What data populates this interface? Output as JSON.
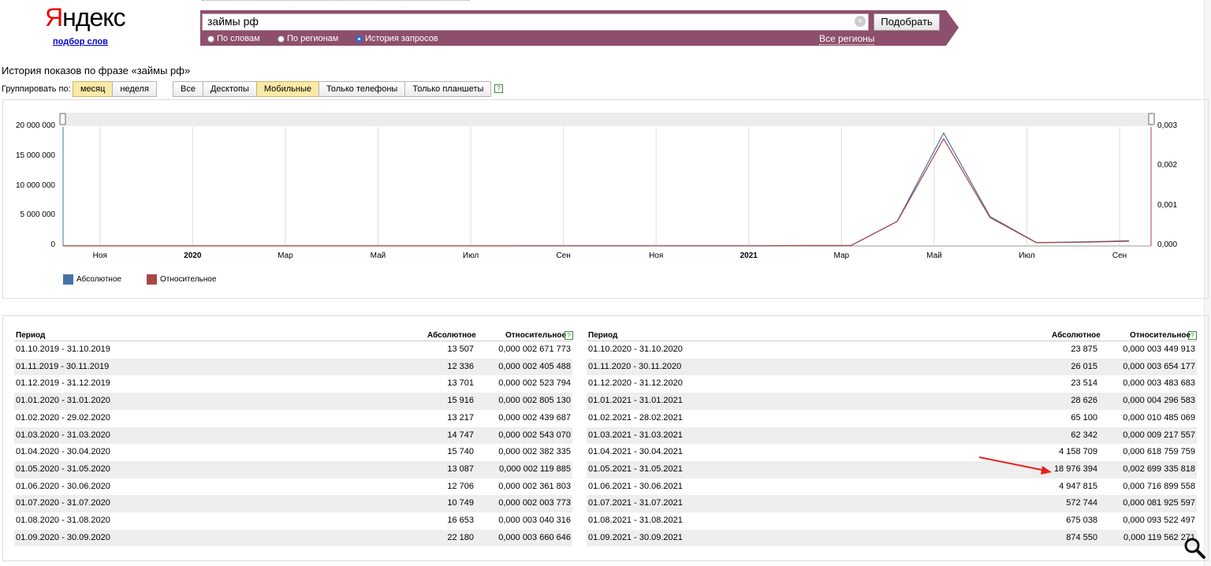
{
  "logo": {
    "first_letter": "Я",
    "rest": "ндекс",
    "sublink": "подбор слов"
  },
  "search": {
    "value": "займы рф",
    "button": "Подобрать",
    "regions": "Все регионы",
    "modes": [
      {
        "label": "По словам",
        "selected": false
      },
      {
        "label": "По регионам",
        "selected": false
      },
      {
        "label": "История запросов",
        "selected": true
      }
    ]
  },
  "history_title": "История показов по фразе «займы рф»",
  "group_label": "Группировать по:",
  "group_buttons": [
    {
      "label": "месяц",
      "active": true
    },
    {
      "label": "неделя",
      "active": false
    }
  ],
  "device_buttons": [
    {
      "label": "Все",
      "active": false
    },
    {
      "label": "Десктопы",
      "active": false
    },
    {
      "label": "Мобильные",
      "active": true
    },
    {
      "label": "Только телефоны",
      "active": false
    },
    {
      "label": "Только планшеты",
      "active": false
    }
  ],
  "help_glyph": "?",
  "chart_data": {
    "type": "line",
    "y_left_ticks": [
      "20 000 000",
      "15 000 000",
      "10 000 000",
      "5 000 000",
      "0"
    ],
    "y_right_ticks": [
      "0,003",
      "0,002",
      "0,001",
      "0,000"
    ],
    "x_ticks": [
      {
        "label": "Ноя",
        "bold": false
      },
      {
        "label": "2020",
        "bold": true
      },
      {
        "label": "Мар",
        "bold": false
      },
      {
        "label": "Май",
        "bold": false
      },
      {
        "label": "Июл",
        "bold": false
      },
      {
        "label": "Сен",
        "bold": false
      },
      {
        "label": "Ноя",
        "bold": false
      },
      {
        "label": "2021",
        "bold": true
      },
      {
        "label": "Мар",
        "bold": false
      },
      {
        "label": "Май",
        "bold": false
      },
      {
        "label": "Июл",
        "bold": false
      },
      {
        "label": "Сен",
        "bold": false
      }
    ],
    "ylim_left": [
      0,
      20000000
    ],
    "ylim_right": [
      0,
      0.003
    ],
    "series": [
      {
        "name": "Абсолютное",
        "color": "#4572a7",
        "values": [
          13507,
          12336,
          13701,
          15916,
          13217,
          14747,
          15740,
          13087,
          12706,
          10749,
          16653,
          22180,
          23875,
          26015,
          23514,
          28626,
          65100,
          62342,
          4158709,
          18976394,
          4947815,
          572744,
          675038,
          874550
        ]
      },
      {
        "name": "Относительное",
        "color": "#aa4643",
        "values": [
          2.671773e-06,
          2.405488e-06,
          2.523794e-06,
          2.80513e-06,
          2.439687e-06,
          2.54307e-06,
          2.382335e-06,
          2.119885e-06,
          2.361803e-06,
          2.003773e-06,
          3.040316e-06,
          3.660646e-06,
          3.449913e-06,
          3.654177e-06,
          3.483683e-06,
          4.296583e-06,
          1.0485069e-05,
          9.217557e-06,
          0.000618759759,
          0.002699335818,
          0.000716899558,
          8.1925597e-05,
          9.3522497e-05,
          0.000119562271
        ]
      }
    ]
  },
  "table": {
    "headers": {
      "period": "Период",
      "absolute": "Абсолютное",
      "relative": "Относительное"
    },
    "left": [
      [
        "01.10.2019 - 31.10.2019",
        "13 507",
        "0,000 002 671 773"
      ],
      [
        "01.11.2019 - 30.11.2019",
        "12 336",
        "0,000 002 405 488"
      ],
      [
        "01.12.2019 - 31.12.2019",
        "13 701",
        "0,000 002 523 794"
      ],
      [
        "01.01.2020 - 31.01.2020",
        "15 916",
        "0,000 002 805 130"
      ],
      [
        "01.02.2020 - 29.02.2020",
        "13 217",
        "0,000 002 439 687"
      ],
      [
        "01.03.2020 - 31.03.2020",
        "14 747",
        "0,000 002 543 070"
      ],
      [
        "01.04.2020 - 30.04.2020",
        "15 740",
        "0,000 002 382 335"
      ],
      [
        "01.05.2020 - 31.05.2020",
        "13 087",
        "0,000 002 119 885"
      ],
      [
        "01.06.2020 - 30.06.2020",
        "12 706",
        "0,000 002 361 803"
      ],
      [
        "01.07.2020 - 31.07.2020",
        "10 749",
        "0,000 002 003 773"
      ],
      [
        "01.08.2020 - 31.08.2020",
        "16 653",
        "0,000 003 040 316"
      ],
      [
        "01.09.2020 - 30.09.2020",
        "22 180",
        "0,000 003 660 646"
      ]
    ],
    "right": [
      [
        "01.10.2020 - 31.10.2020",
        "23 875",
        "0,000 003 449 913"
      ],
      [
        "01.11.2020 - 30.11.2020",
        "26 015",
        "0,000 003 654 177"
      ],
      [
        "01.12.2020 - 31.12.2020",
        "23 514",
        "0,000 003 483 683"
      ],
      [
        "01.01.2021 - 31.01.2021",
        "28 626",
        "0,000 004 296 583"
      ],
      [
        "01.02.2021 - 28.02.2021",
        "65 100",
        "0,000 010 485 069"
      ],
      [
        "01.03.2021 - 31.03.2021",
        "62 342",
        "0,000 009 217 557"
      ],
      [
        "01.04.2021 - 30.04.2021",
        "4 158 709",
        "0,000 618 759 759"
      ],
      [
        "01.05.2021 - 31.05.2021",
        "18 976 394",
        "0,002 699 335 818"
      ],
      [
        "01.06.2021 - 30.06.2021",
        "4 947 815",
        "0,000 716 899 558"
      ],
      [
        "01.07.2021 - 31.07.2021",
        "572 744",
        "0,000 081 925 597"
      ],
      [
        "01.08.2021 - 31.08.2021",
        "675 038",
        "0,000 093 522 497"
      ],
      [
        "01.09.2021 - 30.09.2021",
        "874 550",
        "0,000 119 562 271"
      ]
    ]
  },
  "annotation_arrow_color": "#e8201a"
}
